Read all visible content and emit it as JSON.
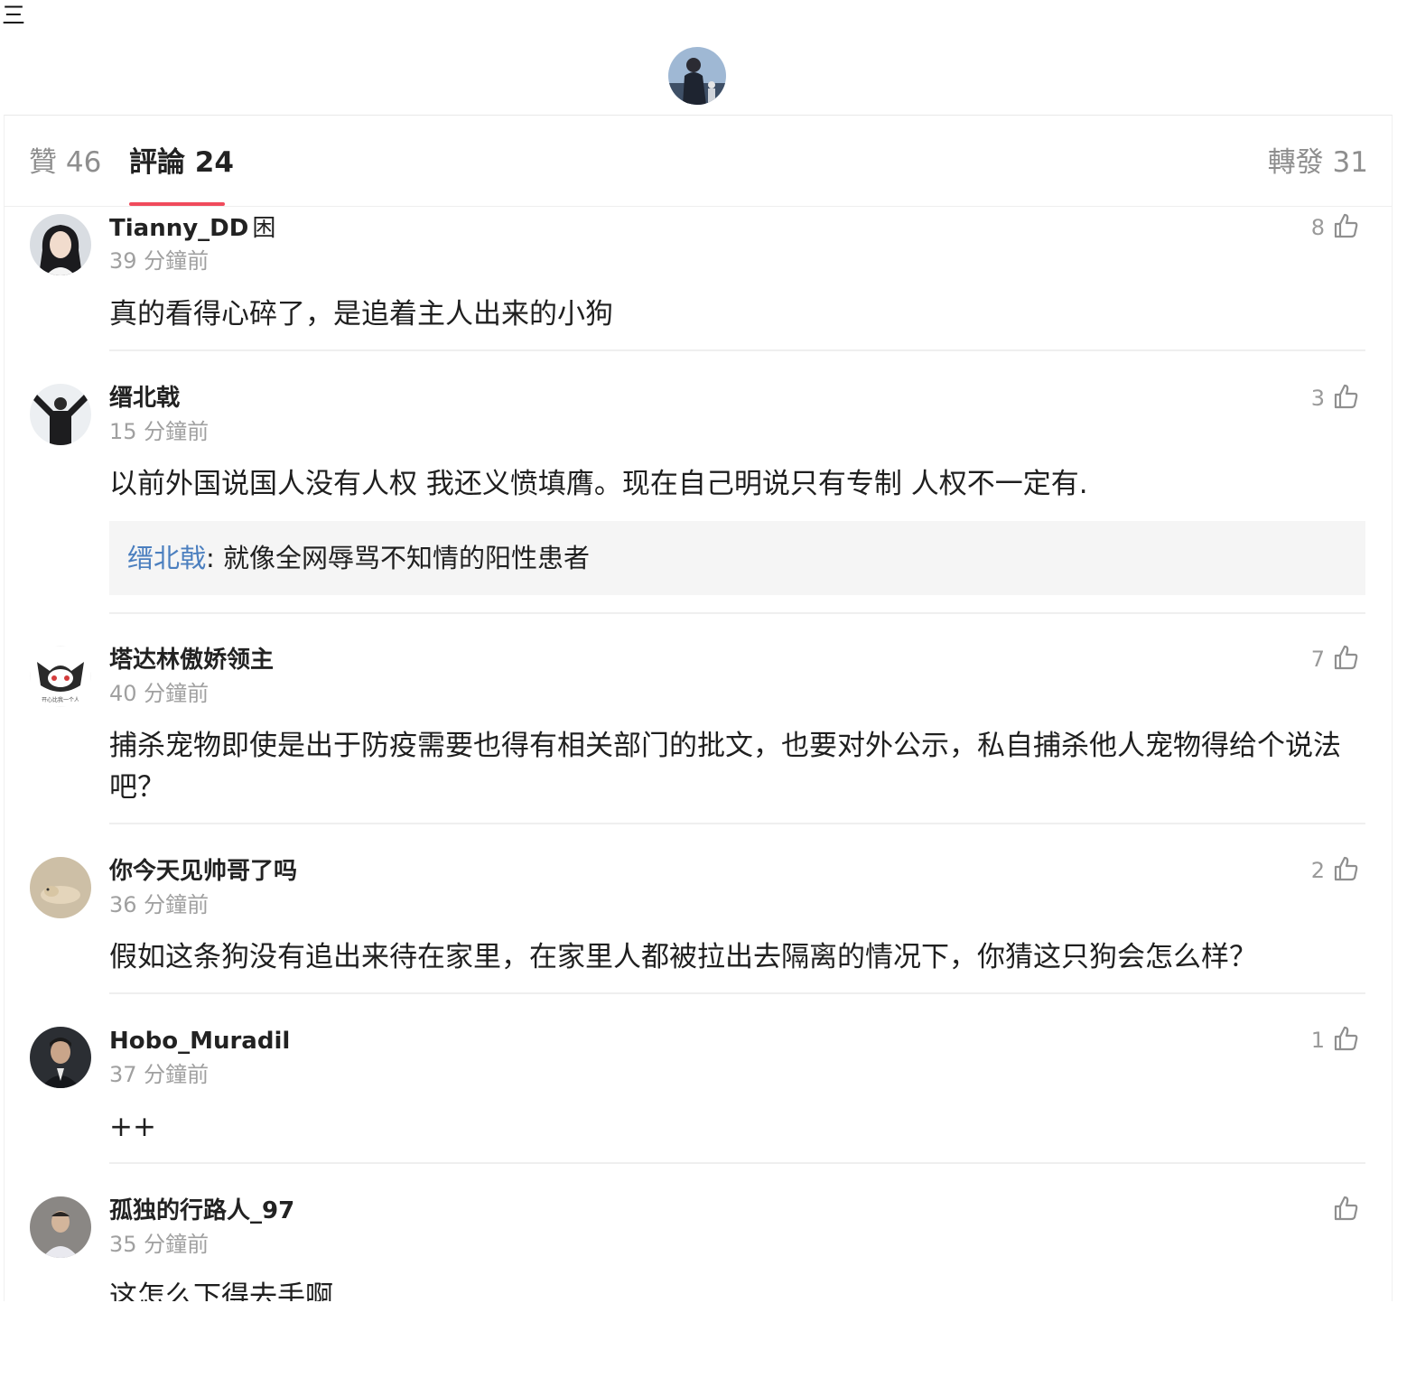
{
  "header": {
    "menu_glyph": "三",
    "avatar_icon": "profile-avatar"
  },
  "tabs": {
    "likes_label": "贊 46",
    "comments_label": "評論 24",
    "reposts_label": "轉發 31"
  },
  "comments": [
    {
      "user": "Tianny_DD",
      "user_badge": "困",
      "time": "39 分鐘前",
      "likes": "8",
      "text": "真的看得心碎了，是追着主人出来的小狗"
    },
    {
      "user": "缙北戟",
      "time": "15 分鐘前",
      "likes": "3",
      "text": "以前外国说国人没有人权 我还义愤填膺。现在自己明说只有专制 人权不一定有.",
      "reply": {
        "user": "缙北戟",
        "sep": ": ",
        "text": "就像全网辱骂不知情的阳性患者"
      }
    },
    {
      "user": "塔达林傲娇领主",
      "avatar_caption": "开心比我一个人",
      "time": "40 分鐘前",
      "likes": "7",
      "text": "捕杀宠物即使是出于防疫需要也得有相关部门的批文，也要对外公示，私自捕杀他人宠物得给个说法吧？"
    },
    {
      "user": "你今天见帅哥了吗",
      "time": "36 分鐘前",
      "likes": "2",
      "text": "假如这条狗没有追出来待在家里，在家里人都被拉出去隔离的情况下，你猜这只狗会怎么样？"
    },
    {
      "user": "Hobo_Muradil",
      "time": "37 分鐘前",
      "likes": "1",
      "text": "++"
    },
    {
      "user": "孤独的行路人_97",
      "time": "35 分鐘前",
      "likes": "",
      "text": "这怎么下得去手啊"
    }
  ],
  "icons": {
    "like": "thumbs-up-outline-icon"
  },
  "colors": {
    "accent_underline": "#f04b5c",
    "reply_user": "#4b7fbf",
    "muted_text": "#a0a0a0",
    "reply_bg": "#f5f5f5"
  }
}
